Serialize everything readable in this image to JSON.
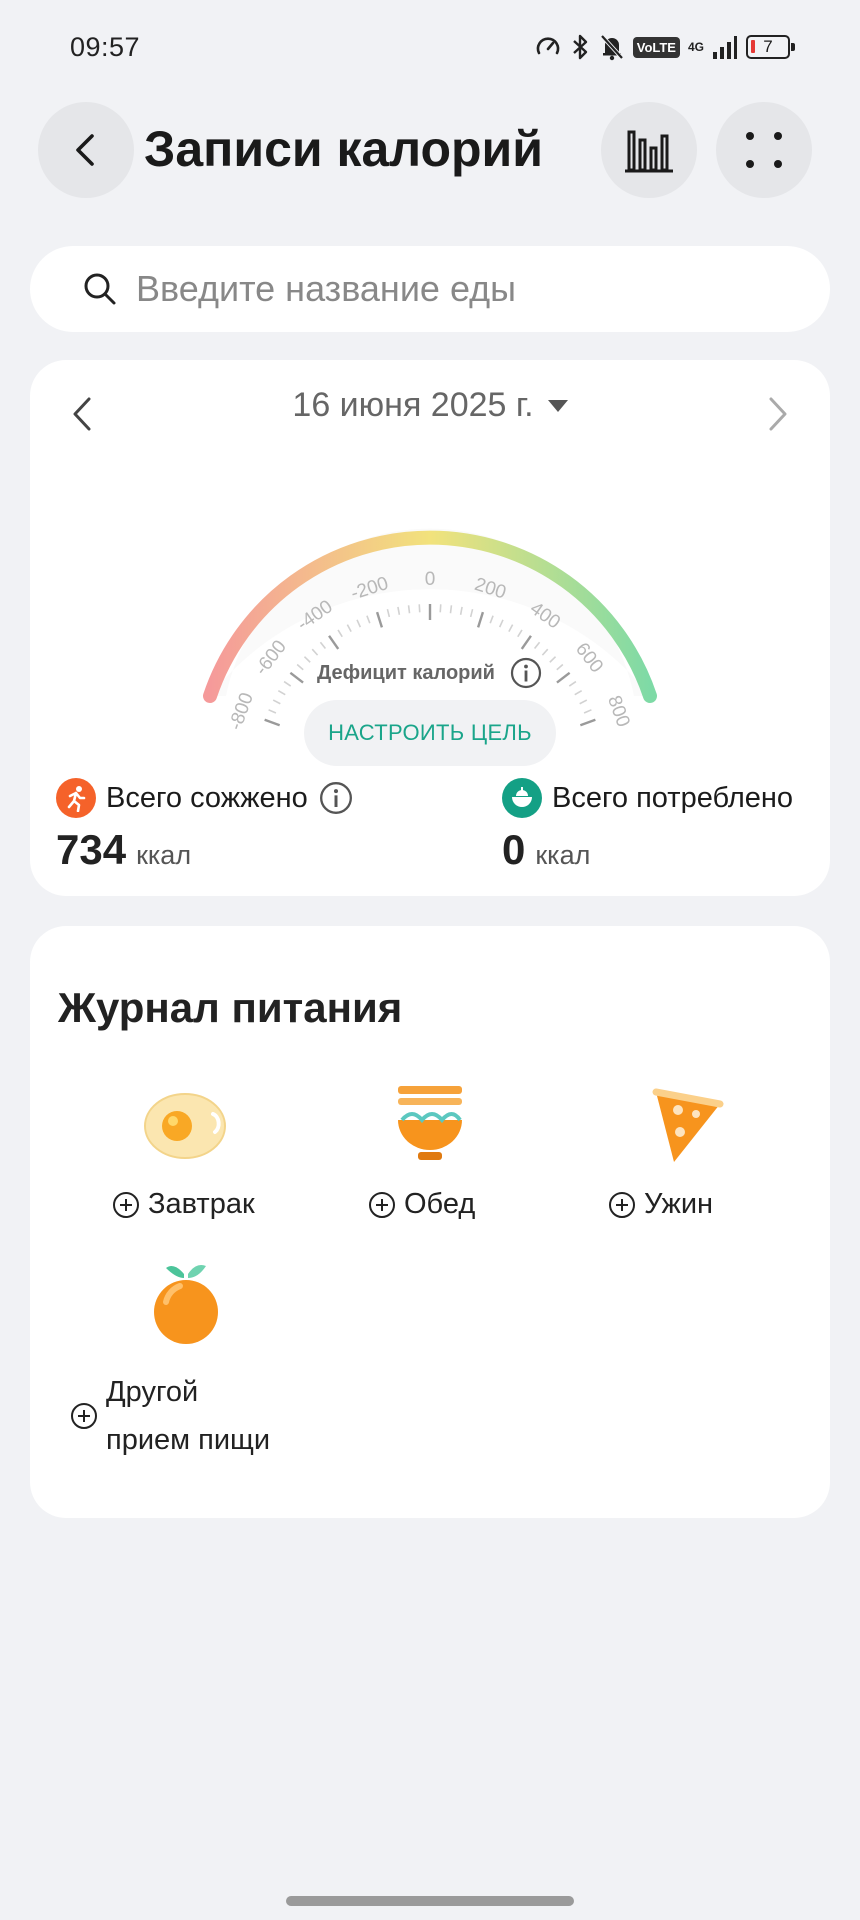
{
  "status_bar": {
    "time": "09:57",
    "battery": "7",
    "volte": "VoLTE",
    "network": "4G"
  },
  "header": {
    "title": "Записи калорий"
  },
  "search": {
    "placeholder": "Введите название еды"
  },
  "date_picker": {
    "date": "16 июня 2025 г."
  },
  "gauge": {
    "ticks": [
      "-800",
      "-600",
      "-400",
      "-200",
      "0",
      "200",
      "400",
      "600",
      "800"
    ],
    "label": "Дефицит калорий",
    "goal_button": "НАСТРОИТЬ ЦЕЛЬ"
  },
  "stats": {
    "burned": {
      "label": "Всего сожжено",
      "value": "734",
      "unit": "ккал"
    },
    "consumed": {
      "label": "Всего потреблено",
      "value": "0",
      "unit": "ккал"
    }
  },
  "journal": {
    "title": "Журнал питания",
    "meals": {
      "breakfast": "Завтрак",
      "lunch": "Обед",
      "dinner": "Ужин",
      "other_line1": "Другой",
      "other_line2": "прием пищи"
    }
  },
  "colors": {
    "accent": "#1aa58a",
    "burned_icon": "#f5622a",
    "consumed_icon": "#14a085",
    "gauge_start": "#f59a9a",
    "gauge_mid": "#f2e27c",
    "gauge_end": "#7edaa6"
  }
}
